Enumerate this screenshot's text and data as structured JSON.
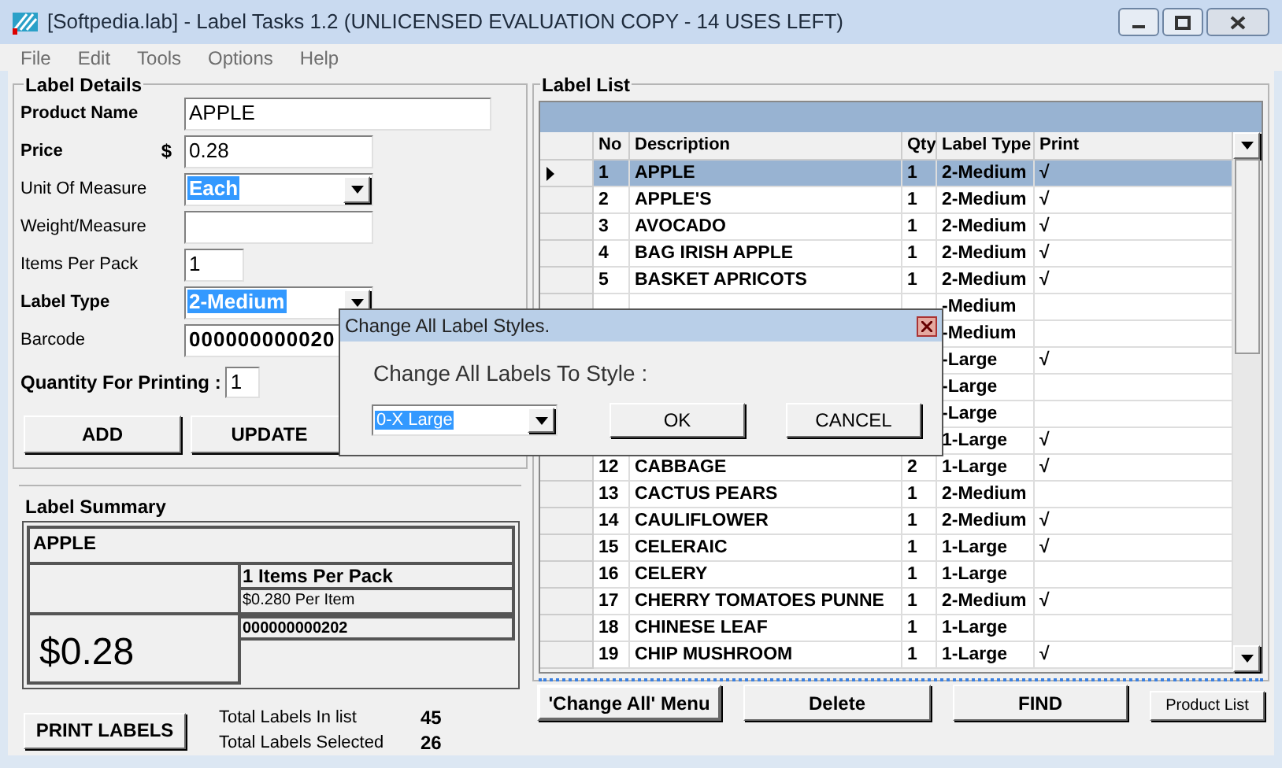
{
  "window": {
    "title": "[Softpedia.lab] - Label Tasks 1.2 (UNLICENSED EVALUATION COPY -  14 USES LEFT)"
  },
  "menu": [
    "File",
    "Edit",
    "Tools",
    "Options",
    "Help"
  ],
  "label_details": {
    "title": "Label Details",
    "fields": [
      {
        "kind": "text",
        "label": "Product Name",
        "bold": true,
        "value": "APPLE"
      },
      {
        "kind": "price",
        "label": "Price",
        "bold": true,
        "currency": "$",
        "value": "0.28"
      },
      {
        "kind": "select",
        "label": "Unit Of Measure",
        "bold": false,
        "value": "Each"
      },
      {
        "kind": "text",
        "label": "Weight/Measure",
        "bold": false
      },
      {
        "kind": "text",
        "label": "Items Per Pack",
        "bold": false,
        "value": "1"
      },
      {
        "kind": "select",
        "label": "Label Type",
        "bold": true,
        "value": "2-Medium"
      },
      {
        "kind": "text",
        "label": "Barcode",
        "bold": false,
        "value": "000000000020"
      }
    ],
    "quantity": {
      "label": "Quantity For Printing :",
      "value": "1"
    },
    "buttons": [
      "ADD",
      "UPDATE"
    ]
  },
  "label_summary": {
    "title": "Label Summary",
    "name": "APPLE",
    "items_per_pack": "1 Items Per Pack",
    "per_item": "$0.280 Per Item",
    "price": "$0.28",
    "barcode": "000000000202"
  },
  "print_button": "PRINT LABELS",
  "totals": [
    {
      "label": "Total Labels In list",
      "value": "45"
    },
    {
      "label": "Total Labels Selected",
      "value": "26"
    }
  ],
  "label_list": {
    "title": "Label List",
    "columns": [
      "No",
      "Description",
      "Qty",
      "Label Type",
      "Print"
    ],
    "rows": [
      {
        "no": "1",
        "description": "APPLE",
        "qty": "1",
        "label_type": "2-Medium",
        "print": true,
        "selected": true
      },
      {
        "no": "2",
        "description": "APPLE'S",
        "qty": "1",
        "label_type": "2-Medium",
        "print": true,
        "selected": false
      },
      {
        "no": "3",
        "description": "AVOCADO",
        "qty": "1",
        "label_type": "2-Medium",
        "print": true,
        "selected": false
      },
      {
        "no": "4",
        "description": "BAG IRISH APPLE",
        "qty": "1",
        "label_type": "2-Medium",
        "print": true,
        "selected": false
      },
      {
        "no": "5",
        "description": "BASKET APRICOTS",
        "qty": "1",
        "label_type": "2-Medium",
        "print": true,
        "selected": false
      },
      {
        "label_type": "-Medium",
        "print": false,
        "selected": false
      },
      {
        "label_type": "-Medium",
        "print": false,
        "selected": false
      },
      {
        "label_type": "-Large",
        "print": true,
        "selected": false
      },
      {
        "label_type": "-Large",
        "print": false,
        "selected": false
      },
      {
        "label_type": "-Large",
        "print": false,
        "selected": false
      },
      {
        "label_type": "1-Large",
        "print": true,
        "selected": false
      },
      {
        "no": "12",
        "description": "CABBAGE",
        "qty": "2",
        "label_type": "1-Large",
        "print": true,
        "selected": false
      },
      {
        "no": "13",
        "description": "CACTUS PEARS",
        "qty": "1",
        "label_type": "2-Medium",
        "print": false,
        "selected": false
      },
      {
        "no": "14",
        "description": "CAULIFLOWER",
        "qty": "1",
        "label_type": "2-Medium",
        "print": true,
        "selected": false
      },
      {
        "no": "15",
        "description": "CELERAIC",
        "qty": "1",
        "label_type": "1-Large",
        "print": true,
        "selected": false
      },
      {
        "no": "16",
        "description": "CELERY",
        "qty": "1",
        "label_type": "1-Large",
        "print": false,
        "selected": false
      },
      {
        "no": "17",
        "description": "CHERRY TOMATOES PUNNE",
        "qty": "1",
        "label_type": "2-Medium",
        "print": true,
        "selected": false
      },
      {
        "no": "18",
        "description": "CHINESE LEAF",
        "qty": "1",
        "label_type": "1-Large",
        "print": false,
        "selected": false
      },
      {
        "no": "19",
        "description": "CHIP MUSHROOM",
        "qty": "1",
        "label_type": "1-Large",
        "print": true,
        "selected": false
      }
    ],
    "check_mark": "√",
    "buttons": [
      "'Change All' Menu",
      "Delete",
      "FIND"
    ],
    "small_button": "Product List"
  },
  "dialog": {
    "title": "Change All Label Styles.",
    "prompt": "Change All Labels To Style :",
    "value": "0-X Large",
    "buttons": [
      "OK",
      "CANCEL"
    ]
  }
}
